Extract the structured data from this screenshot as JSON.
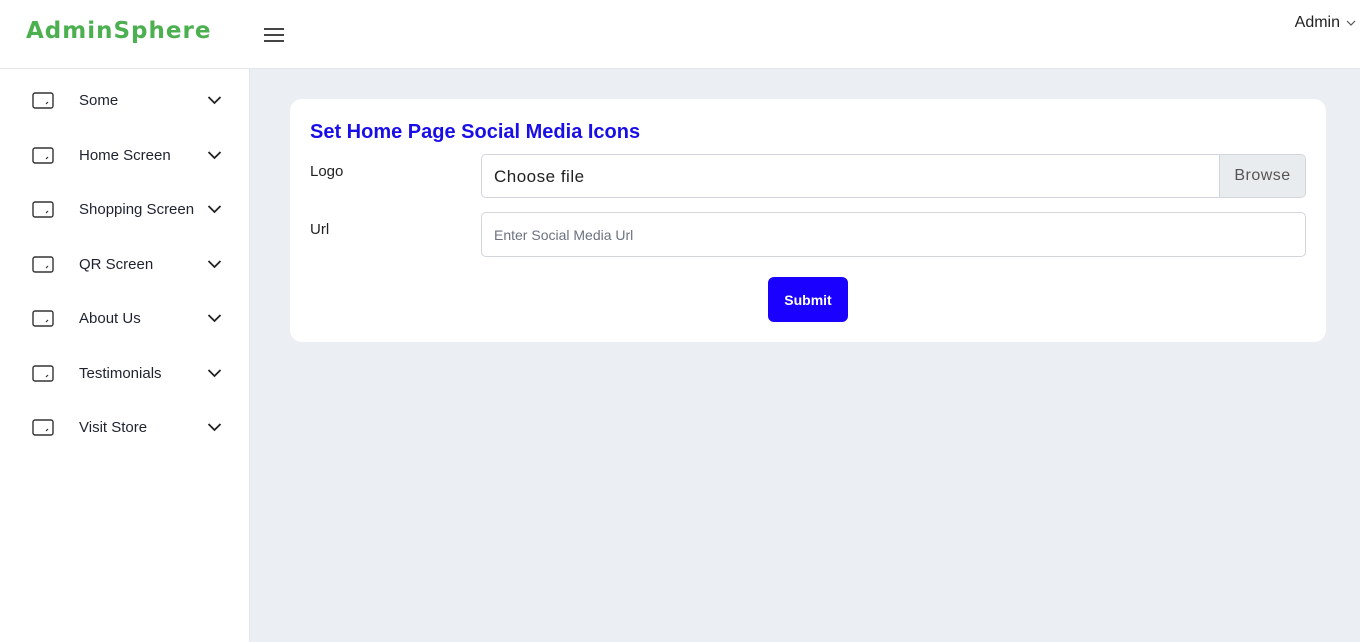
{
  "header": {
    "brand": "AdminSphere",
    "user_label": "Admin"
  },
  "sidebar": {
    "items": [
      {
        "label": "Some"
      },
      {
        "label": "Home Screen"
      },
      {
        "label": "Shopping Screen"
      },
      {
        "label": "QR Screen"
      },
      {
        "label": "About Us"
      },
      {
        "label": "Testimonials"
      },
      {
        "label": "Visit Store"
      }
    ]
  },
  "form": {
    "title": "Set Home Page Social Media Icons",
    "logo_label": "Logo",
    "file_text": "Choose file",
    "browse_label": "Browse",
    "url_label": "Url",
    "url_placeholder": "Enter Social Media Url",
    "url_value": "",
    "submit_label": "Submit"
  },
  "icons": {
    "sidebar_item": "tablet-icon",
    "sidebar_chevron": "chevron-down-icon",
    "menu": "hamburger-menu-icon",
    "user_dropdown": "chevron-down-icon"
  },
  "colors": {
    "brand": "#4caf50",
    "title": "#1a0ee8",
    "button": "#1a00ff"
  }
}
